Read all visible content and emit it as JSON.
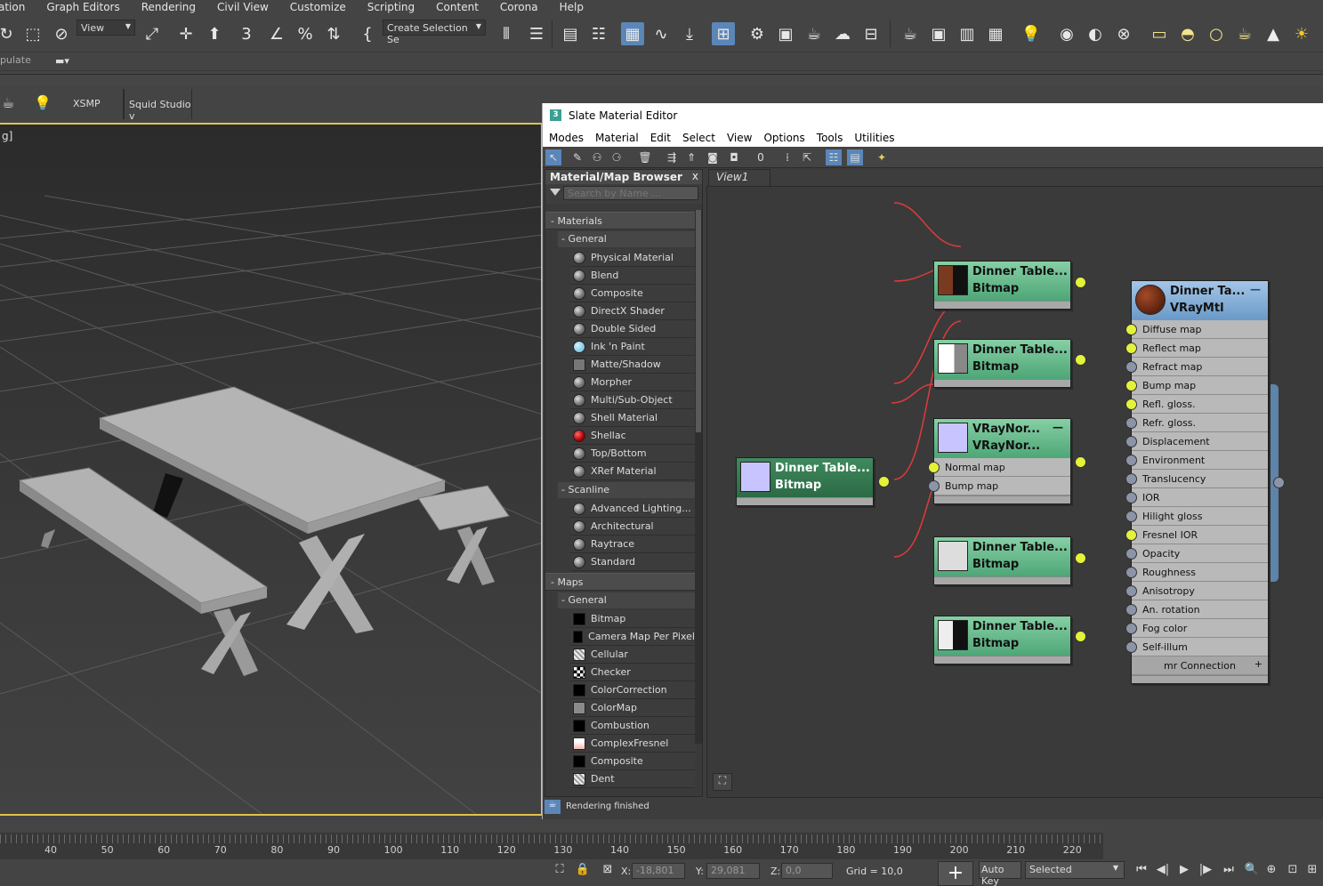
{
  "menubar": [
    "ation",
    "Graph Editors",
    "Rendering",
    "Civil View",
    "Customize",
    "Scripting",
    "Content",
    "Corona",
    "Help"
  ],
  "toolbar": {
    "view_dropdown": "View",
    "selection_set_dropdown": "Create Selection Se"
  },
  "secondary": {
    "populate_label": "pulate"
  },
  "ribbon": {
    "xsmp": "XSMP",
    "squid": "Squid Studio v"
  },
  "viewport": {
    "label": "g]"
  },
  "sme": {
    "title": "Slate Material Editor",
    "menu": [
      "Modes",
      "Material",
      "Edit",
      "Select",
      "View",
      "Options",
      "Tools",
      "Utilities"
    ],
    "browser": {
      "title": "Material/Map Browser",
      "close": "x",
      "search_placeholder": "Search by Name ...",
      "materials_label": "- Materials",
      "general_label": "- General",
      "materials_general": [
        {
          "label": "Physical Material",
          "swatch": "sphere"
        },
        {
          "label": "Blend",
          "swatch": "sphere"
        },
        {
          "label": "Composite",
          "swatch": "sphere"
        },
        {
          "label": "DirectX Shader",
          "swatch": "sphere"
        },
        {
          "label": "Double Sided",
          "swatch": "sphere"
        },
        {
          "label": "Ink 'n Paint",
          "swatch": "ink"
        },
        {
          "label": "Matte/Shadow",
          "swatch": "matte"
        },
        {
          "label": "Morpher",
          "swatch": "sphere"
        },
        {
          "label": "Multi/Sub-Object",
          "swatch": "sphere"
        },
        {
          "label": "Shell Material",
          "swatch": "sphere"
        },
        {
          "label": "Shellac",
          "swatch": "red"
        },
        {
          "label": "Top/Bottom",
          "swatch": "sphere"
        },
        {
          "label": "XRef Material",
          "swatch": "sphere"
        }
      ],
      "scanline_label": "- Scanline",
      "materials_scanline": [
        {
          "label": "Advanced Lighting...",
          "swatch": "sphere"
        },
        {
          "label": "Architectural",
          "swatch": "sphere"
        },
        {
          "label": "Raytrace",
          "swatch": "sphere"
        },
        {
          "label": "Standard",
          "swatch": "sphere"
        }
      ],
      "maps_label": "- Maps",
      "maps_general_label": "- General",
      "maps_general": [
        {
          "label": "Bitmap",
          "swatch": "black"
        },
        {
          "label": "Camera Map Per Pixel",
          "swatch": "black"
        },
        {
          "label": "Cellular",
          "swatch": "noise"
        },
        {
          "label": "Checker",
          "swatch": "checker"
        },
        {
          "label": "ColorCorrection",
          "swatch": "black"
        },
        {
          "label": "ColorMap",
          "swatch": "grey"
        },
        {
          "label": "Combustion",
          "swatch": "black"
        },
        {
          "label": "ComplexFresnel",
          "swatch": "pink"
        },
        {
          "label": "Composite",
          "swatch": "black"
        },
        {
          "label": "Dent",
          "swatch": "noise"
        }
      ]
    },
    "view_tab": "View1",
    "status": "Rendering finished"
  },
  "nodes": {
    "bitmap1": {
      "title": "Dinner  Table...",
      "type": "Bitmap"
    },
    "bitmap2": {
      "title": "Dinner  Table...",
      "type": "Bitmap"
    },
    "bitmap3": {
      "title": "Dinner  Table...",
      "type": "Bitmap"
    },
    "bitmap4": {
      "title": "Dinner  Table...",
      "type": "Bitmap"
    },
    "bitmap5": {
      "title": "Dinner  Table...",
      "type": "Bitmap"
    },
    "vraynormal": {
      "title": "VRayNor...",
      "type": "VRayNor...",
      "slots": [
        "Normal map",
        "Bump map"
      ]
    },
    "vraymtl": {
      "title": "Dinner  Ta...",
      "type": "VRayMtl",
      "slots": [
        "Diffuse map",
        "Reflect map",
        "Refract map",
        "Bump map",
        "Refl. gloss.",
        "Refr. gloss.",
        "Displacement",
        "Environment",
        "Translucency",
        "IOR",
        "Hilight gloss",
        "Fresnel IOR",
        "Opacity",
        "Roughness",
        "Anisotropy",
        "An. rotation",
        "Fog color",
        "Self-illum"
      ],
      "connected": [
        true,
        true,
        false,
        true,
        true,
        false,
        false,
        false,
        false,
        false,
        false,
        true,
        false,
        false,
        false,
        false,
        false,
        false
      ],
      "footer": "mr Connection"
    }
  },
  "timeline": {
    "ticks": [
      "40",
      "50",
      "60",
      "70",
      "80",
      "90",
      "100",
      "110",
      "120",
      "130",
      "140",
      "150",
      "160",
      "170",
      "180",
      "190",
      "200",
      "210",
      "220"
    ]
  },
  "bottombar": {
    "x_label": "X:",
    "x_value": "-18,801",
    "y_label": "Y:",
    "y_value": "29,081",
    "z_label": "Z:",
    "z_value": "0,0",
    "grid": "Grid = 10,0",
    "autokey": "Auto Key",
    "selected": "Selected"
  }
}
